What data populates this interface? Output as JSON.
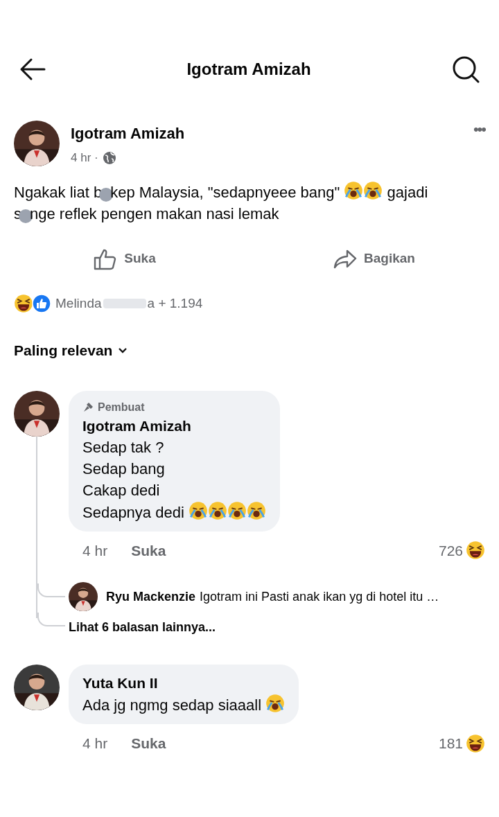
{
  "header": {
    "title": "Igotram Amizah"
  },
  "post": {
    "author": "Igotram Amizah",
    "time": "4 hr ·",
    "more": "•••",
    "lines": [
      [
        {
          "kind": "text",
          "text": "Ngakak liat b"
        },
        {
          "kind": "mask"
        },
        {
          "kind": "text",
          "text": "kep Malaysia, \"sedapnyeee bang\" "
        },
        {
          "kind": "crying-emoji"
        },
        {
          "kind": "crying-emoji"
        },
        {
          "kind": "text",
          "text": " gajadi"
        }
      ],
      [
        {
          "kind": "text",
          "text": "s"
        },
        {
          "kind": "mask"
        },
        {
          "kind": "text",
          "text": "nge reflek pengen makan nasi lemak"
        }
      ]
    ],
    "actions": [
      {
        "kind": "like",
        "label": "Suka"
      },
      {
        "kind": "share",
        "label": "Bagikan"
      }
    ],
    "reactions": {
      "name_start": "Melinda",
      "name_end": "a + 1.194"
    }
  },
  "sort": {
    "label": "Paling relevan"
  },
  "comments": [
    {
      "badge": "Pembuat",
      "author": "Igotram Amizah",
      "lines": [
        [
          {
            "kind": "text",
            "text": "Sedap tak ?"
          }
        ],
        [
          {
            "kind": "text",
            "text": "Sedap bang"
          }
        ],
        [
          {
            "kind": "text",
            "text": "Cakap dedi"
          }
        ],
        [
          {
            "kind": "text",
            "text": "Sedapnya dedi "
          },
          {
            "kind": "crying-emoji"
          },
          {
            "kind": "crying-emoji"
          },
          {
            "kind": "crying-emoji"
          },
          {
            "kind": "crying-emoji"
          }
        ]
      ],
      "time": "4 hr",
      "like": "Suka",
      "count": "726",
      "replies": [
        {
          "author": "Ryu Mackenzie",
          "text": "Igotram ini Pasti anak ikan yg di hotel itu …"
        }
      ],
      "more_replies": "Lihat 6 balasan lainnya..."
    },
    {
      "author": "Yuta Kun II",
      "lines": [
        [
          {
            "kind": "text",
            "text": "Ada jg ngmg sedap siaaall "
          },
          {
            "kind": "crying-emoji"
          }
        ]
      ],
      "time": "4 hr",
      "like": "Suka",
      "count": "181"
    }
  ]
}
